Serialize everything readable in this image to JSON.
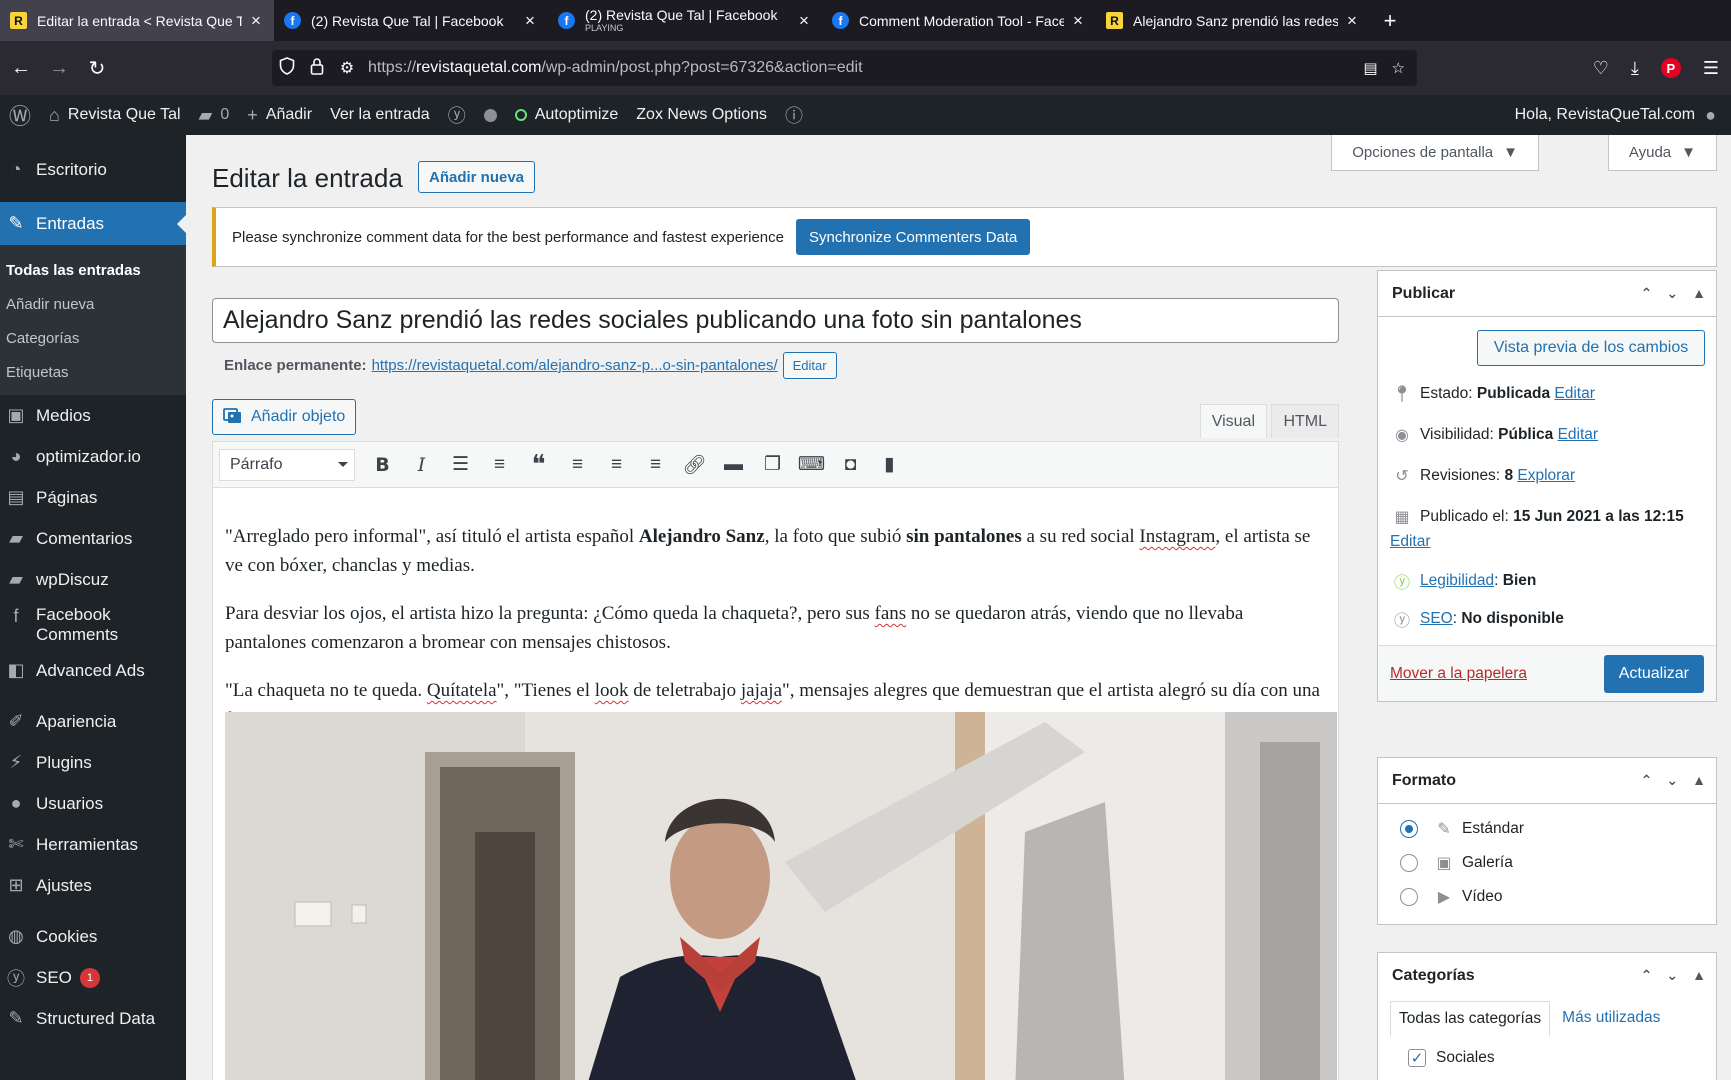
{
  "browser": {
    "tabs": [
      {
        "title": "Editar la entrada < Revista Que Tal",
        "sub": "",
        "favicon": "R",
        "kind": "rq",
        "active": true
      },
      {
        "title": "(2) Revista Que Tal | Facebook",
        "sub": "",
        "favicon": "f",
        "kind": "fb",
        "active": false
      },
      {
        "title": "(2) Revista Que Tal | Facebook",
        "sub": "PLAYING",
        "favicon": "f",
        "kind": "fb",
        "active": false
      },
      {
        "title": "Comment Moderation Tool - Facebook",
        "sub": "",
        "favicon": "f",
        "kind": "fb",
        "active": false
      },
      {
        "title": "Alejandro Sanz prendió las redes sociales",
        "sub": "",
        "favicon": "R",
        "kind": "rq",
        "active": false
      }
    ],
    "url_prefix": "https://",
    "url_domain": "revistaquetal.com",
    "url_path": "/wp-admin/post.php?post=67326&action=edit"
  },
  "adminbar": {
    "site_name": "Revista Que Tal",
    "comments_count": "0",
    "add_label": "Añadir",
    "view_label": "Ver la entrada",
    "autoptimize": "Autoptimize",
    "zox": "Zox News Options",
    "greeting": "Hola, RevistaQueTal.com"
  },
  "sidebar": {
    "dashboard": "Escritorio",
    "posts": "Entradas",
    "sub": [
      "Todas las entradas",
      "Añadir nueva",
      "Categorías",
      "Etiquetas"
    ],
    "items": [
      "Medios",
      "optimizador.io",
      "Páginas",
      "Comentarios",
      "wpDiscuz",
      "Facebook Comments",
      "Advanced Ads"
    ],
    "items2": [
      "Apariencia",
      "Plugins",
      "Usuarios",
      "Herramientas",
      "Ajustes"
    ],
    "cookies": "Cookies",
    "seo": "SEO",
    "seo_badge": "1",
    "structured": "Structured Data"
  },
  "header": {
    "screen_options": "Opciones de pantalla",
    "help": "Ayuda",
    "title": "Editar la entrada",
    "add_new": "Añadir nueva"
  },
  "notice": {
    "text": "Please synchronize comment data for the best performance and fastest experience",
    "button": "Synchronize Commenters Data"
  },
  "editor": {
    "post_title": "Alejandro Sanz prendió las redes sociales publicando una foto sin pantalones",
    "permalink_label": "Enlace permanente:",
    "permalink_url": "https://revistaquetal.com/alejandro-sanz-p...o-sin-pantalones/",
    "permalink_edit": "Editar",
    "add_media": "Añadir objeto",
    "tab_visual": "Visual",
    "tab_html": "HTML",
    "format": "Párrafo",
    "p1_a": "\"Arreglado pero informal\", así tituló el artista español ",
    "p1_b": "Alejandro Sanz",
    "p1_c": ", la foto que subió ",
    "p1_d": "sin pantalones",
    "p1_e": " a su red social ",
    "p1_f": "Instagram",
    "p1_g": ", el artista se ve con bóxer, chanclas y medias.",
    "p2_a": "Para desviar los ojos, el artista hizo la pregunta: ¿Cómo queda la chaqueta?, pero sus ",
    "p2_b": "fans",
    "p2_c": " no se quedaron atrás, viendo que no llevaba pantalones comenzaron a bromear con mensajes chistosos.",
    "p3_a": "\"La chaqueta no te queda. ",
    "p3_b": "Quítatela",
    "p3_c": "\", \"Tienes el ",
    "p3_d": "look",
    "p3_e": " de teletrabajo ",
    "p3_f": "jajaja",
    "p3_g": "\", mensajes alegres que demuestran que el artista alegró su día con una foto como esta."
  },
  "publish": {
    "title": "Publicar",
    "preview": "Vista previa de los cambios",
    "status_label": "Estado:",
    "status_value": "Publicada",
    "visibility_label": "Visibilidad:",
    "visibility_value": "Pública",
    "revisions_label": "Revisiones:",
    "revisions_value": "8",
    "explore": "Explorar",
    "published_label": "Publicado el:",
    "published_value": "15 Jun 2021 a las 12:15",
    "edit": "Editar",
    "readability_label": "Legibilidad",
    "readability_value": "Bien",
    "seo_label": "SEO",
    "seo_value": "No disponible",
    "trash": "Mover a la papelera",
    "update": "Actualizar"
  },
  "format_box": {
    "title": "Formato",
    "options": [
      "Estándar",
      "Galería",
      "Vídeo"
    ]
  },
  "categories_box": {
    "title": "Categorías",
    "tab_all": "Todas las categorías",
    "tab_most": "Más utilizadas",
    "first": "Sociales"
  }
}
